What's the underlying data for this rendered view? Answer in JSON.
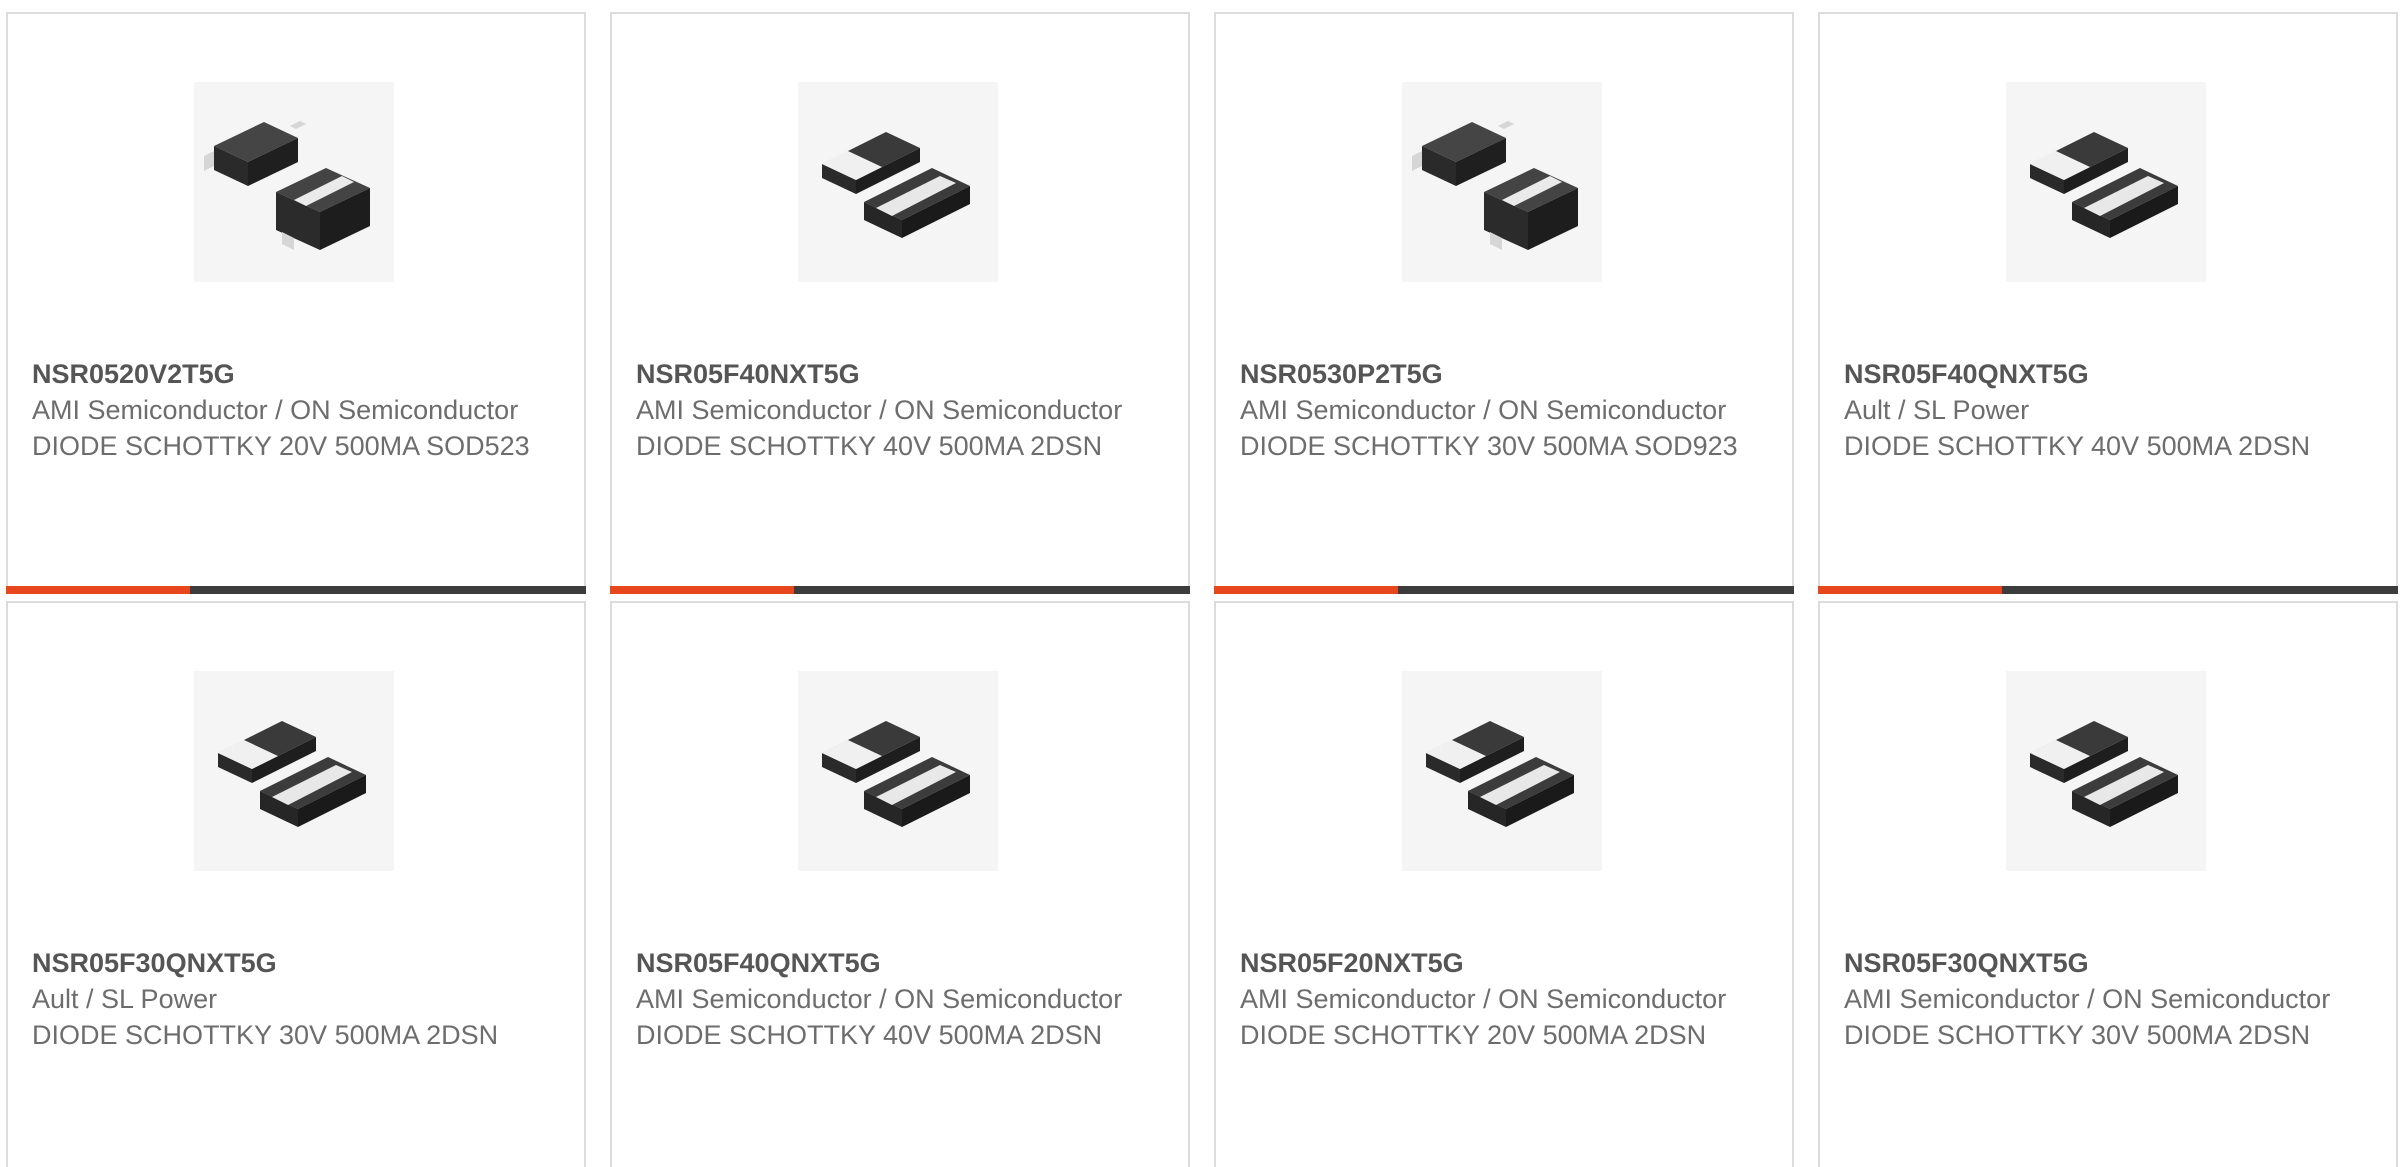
{
  "colors": {
    "accent": "#e8461d",
    "bar": "#3c3c3c",
    "border": "#dcdcdc",
    "text": "#6d6d6d"
  },
  "products": [
    {
      "part_number": "NSR0520V2T5G",
      "manufacturer": "AMI Semiconductor / ON Semiconductor",
      "description": "DIODE SCHOTTKY 20V 500MA SOD523",
      "image_icon": "sod-package-icon"
    },
    {
      "part_number": "NSR05F40NXT5G",
      "manufacturer": "AMI Semiconductor / ON Semiconductor",
      "description": "DIODE SCHOTTKY 40V 500MA 2DSN",
      "image_icon": "dsn-package-icon"
    },
    {
      "part_number": "NSR0530P2T5G",
      "manufacturer": "AMI Semiconductor / ON Semiconductor",
      "description": "DIODE SCHOTTKY 30V 500MA SOD923",
      "image_icon": "sod-package-icon"
    },
    {
      "part_number": "NSR05F40QNXT5G",
      "manufacturer": "Ault / SL Power",
      "description": "DIODE SCHOTTKY 40V 500MA 2DSN",
      "image_icon": "dsn-package-icon"
    },
    {
      "part_number": "NSR05F30QNXT5G",
      "manufacturer": "Ault / SL Power",
      "description": "DIODE SCHOTTKY 30V 500MA 2DSN",
      "image_icon": "dsn-package-icon"
    },
    {
      "part_number": "NSR05F40QNXT5G",
      "manufacturer": "AMI Semiconductor / ON Semiconductor",
      "description": "DIODE SCHOTTKY 40V 500MA 2DSN",
      "image_icon": "dsn-package-icon"
    },
    {
      "part_number": "NSR05F20NXT5G",
      "manufacturer": "AMI Semiconductor / ON Semiconductor",
      "description": "DIODE SCHOTTKY 20V 500MA 2DSN",
      "image_icon": "dsn-package-icon"
    },
    {
      "part_number": "NSR05F30QNXT5G",
      "manufacturer": "AMI Semiconductor / ON Semiconductor",
      "description": "DIODE SCHOTTKY 30V 500MA 2DSN",
      "image_icon": "dsn-package-icon"
    }
  ]
}
